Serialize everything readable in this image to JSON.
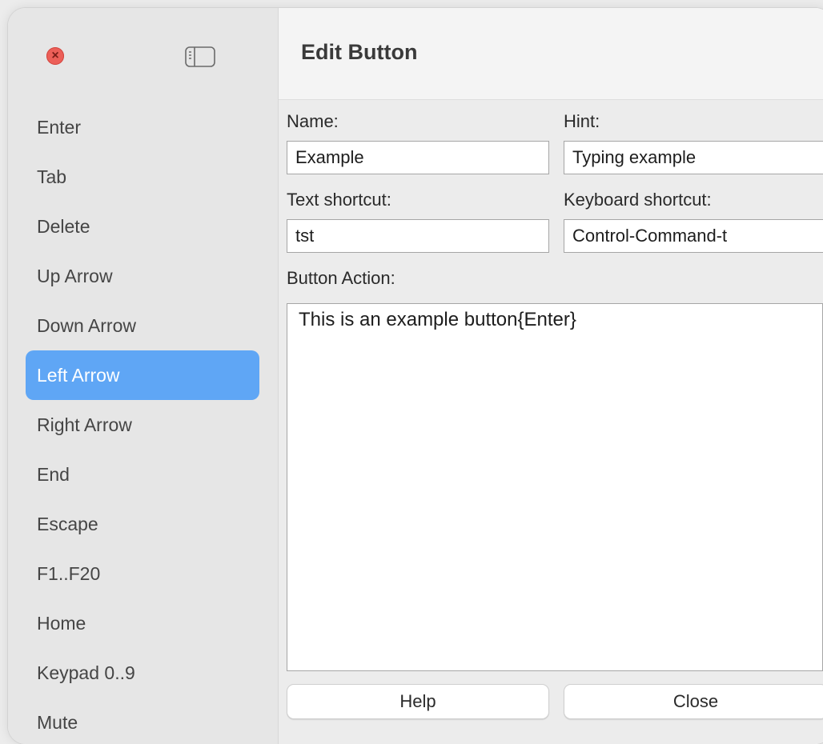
{
  "window": {
    "controls": {
      "close_icon": "close-icon",
      "close_glyph": "×",
      "sidebar_toggle_icon": "sidebar-toggle-icon"
    }
  },
  "sidebar": {
    "items": [
      {
        "label": "Enter",
        "selected": false
      },
      {
        "label": "Tab",
        "selected": false
      },
      {
        "label": "Delete",
        "selected": false
      },
      {
        "label": "Up Arrow",
        "selected": false
      },
      {
        "label": "Down Arrow",
        "selected": false
      },
      {
        "label": "Left Arrow",
        "selected": true
      },
      {
        "label": "Right Arrow",
        "selected": false
      },
      {
        "label": "End",
        "selected": false
      },
      {
        "label": "Escape",
        "selected": false
      },
      {
        "label": "F1..F20",
        "selected": false
      },
      {
        "label": "Home",
        "selected": false
      },
      {
        "label": "Keypad 0..9",
        "selected": false
      },
      {
        "label": "Mute",
        "selected": false
      }
    ]
  },
  "header": {
    "title": "Edit Button"
  },
  "form": {
    "name_label": "Name:",
    "name_value": "Example",
    "hint_label": "Hint:",
    "hint_value": "Typing example",
    "text_shortcut_label": "Text shortcut:",
    "text_shortcut_value": "tst",
    "keyboard_shortcut_label": "Keyboard shortcut:",
    "keyboard_shortcut_value": "Control-Command-t",
    "action_label": "Button Action:",
    "action_value": "This is an example button{Enter}"
  },
  "buttons": {
    "help_label": "Help",
    "close_label": "Close"
  },
  "colors": {
    "selection": "#5fa6f5",
    "close_dot": "#ec5f58",
    "sidebar_bg": "#e6e6e6",
    "header_bg": "#f4f4f4"
  }
}
